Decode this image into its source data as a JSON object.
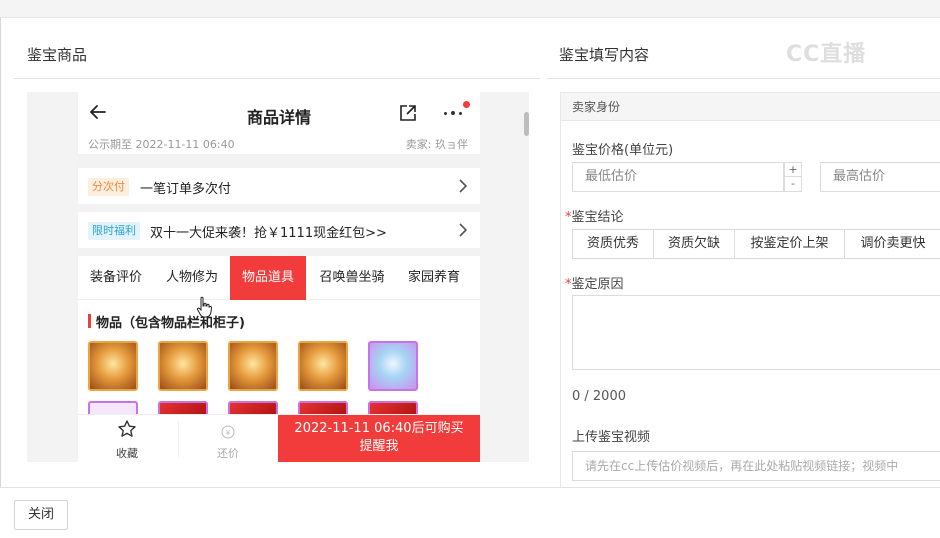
{
  "left_section": {
    "title": "鉴宝商品"
  },
  "right_section": {
    "title": "鉴宝填写内容"
  },
  "watermark": {
    "text": "CC直播"
  },
  "phone": {
    "header": {
      "title": "商品详情"
    },
    "meta": {
      "publicity": "公示期至 2022-11-11 06:40",
      "seller": "卖家: 玖ョ伴"
    },
    "promo_rows": [
      {
        "tag": "分次付",
        "text": "一笔订单多次付"
      },
      {
        "tag": "限时福利",
        "text": "双十一大促来袭！抢￥1111现金红包>>"
      }
    ],
    "tabs": [
      "装备评价",
      "人物修为",
      "物品道具",
      "召唤兽坐骑",
      "家园养育"
    ],
    "active_tab": "物品道具",
    "items_section": {
      "label": "物品（包含物品栏和柜子)"
    },
    "bottom_bar": {
      "favorite": "收藏",
      "bargain": "还价",
      "buy_line1": "2022-11-11 06:40后可购买",
      "buy_line2": "提醒我"
    }
  },
  "form": {
    "section_header": "卖家身份",
    "price": {
      "label": "鉴宝价格(单位元)",
      "min_placeholder": "最低估价",
      "max_placeholder": "最高估价",
      "plus": "+",
      "minus": "-"
    },
    "conclusion": {
      "required": "*",
      "label": "鉴宝结论",
      "options": [
        "资质优秀",
        "资质欠缺",
        "按鉴定价上架",
        "调价卖更快"
      ]
    },
    "reason": {
      "required": "*",
      "label": "鉴定原因",
      "counter": "0 / 2000"
    },
    "video": {
      "label": "上传鉴宝视频",
      "placeholder": "请先在cc上传估价视频后，再在此处粘贴视频链接；视频中"
    }
  },
  "footer": {
    "close_label": "关闭"
  }
}
